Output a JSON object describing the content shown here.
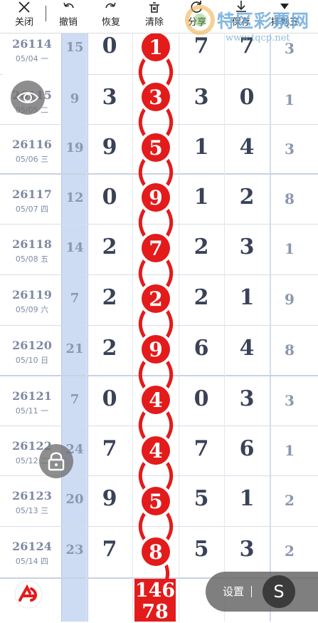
{
  "toolbar": {
    "items": [
      {
        "label": "关闭",
        "icon": "close-icon"
      },
      {
        "label": "撤销",
        "icon": "undo-icon"
      },
      {
        "label": "恢复",
        "icon": "redo-icon"
      },
      {
        "label": "清除",
        "icon": "trash-icon"
      },
      {
        "label": "分享",
        "icon": "share-icon"
      },
      {
        "label": "保存",
        "icon": "download-icon"
      },
      {
        "label": "排列五",
        "icon": "caret-down-icon"
      }
    ]
  },
  "watermark": {
    "name": "特区彩票网",
    "url": "www.tqcp.net"
  },
  "rows": [
    {
      "issue": "26114",
      "date": "05/04 一",
      "span": "15",
      "d1": "0",
      "ball": "1",
      "d3": "7",
      "d4": "7",
      "d5": "3"
    },
    {
      "issue": "26115",
      "date": "05/05 二",
      "span": "9",
      "d1": "3",
      "ball": "3",
      "d3": "3",
      "d4": "0",
      "d5": "1"
    },
    {
      "issue": "26116",
      "date": "05/06 三",
      "span": "19",
      "d1": "9",
      "ball": "5",
      "d3": "1",
      "d4": "4",
      "d5": "3"
    },
    {
      "issue": "26117",
      "date": "05/07 四",
      "span": "12",
      "d1": "0",
      "ball": "9",
      "d3": "1",
      "d4": "2",
      "d5": "8"
    },
    {
      "issue": "26118",
      "date": "05/08 五",
      "span": "14",
      "d1": "2",
      "ball": "7",
      "d3": "2",
      "d4": "3",
      "d5": "1"
    },
    {
      "issue": "26119",
      "date": "05/09 六",
      "span": "7",
      "d1": "2",
      "ball": "2",
      "d3": "2",
      "d4": "1",
      "d5": "9"
    },
    {
      "issue": "26120",
      "date": "05/10 日",
      "span": "21",
      "d1": "2",
      "ball": "9",
      "d3": "6",
      "d4": "4",
      "d5": "8"
    },
    {
      "issue": "26121",
      "date": "05/11 一",
      "span": "7",
      "d1": "0",
      "ball": "4",
      "d3": "0",
      "d4": "3",
      "d5": "3"
    },
    {
      "issue": "26122",
      "date": "05/12 二",
      "span": "24",
      "d1": "7",
      "ball": "4",
      "d3": "7",
      "d4": "6",
      "d5": "1"
    },
    {
      "issue": "26123",
      "date": "05/13 三",
      "span": "20",
      "d1": "9",
      "ball": "5",
      "d3": "5",
      "d4": "1",
      "d5": "2"
    },
    {
      "issue": "26124",
      "date": "05/14 四",
      "span": "23",
      "d1": "7",
      "ball": "8",
      "d3": "5",
      "d4": "3",
      "d5": "2"
    }
  ],
  "result": {
    "line1": "146",
    "line2": "78"
  },
  "settings": {
    "label": "设置",
    "button": "S"
  },
  "colors": {
    "ball": "#e31b1b",
    "span_column": "#cddcf3",
    "digit": "#3a4258",
    "muted": "#7e8aa3"
  }
}
